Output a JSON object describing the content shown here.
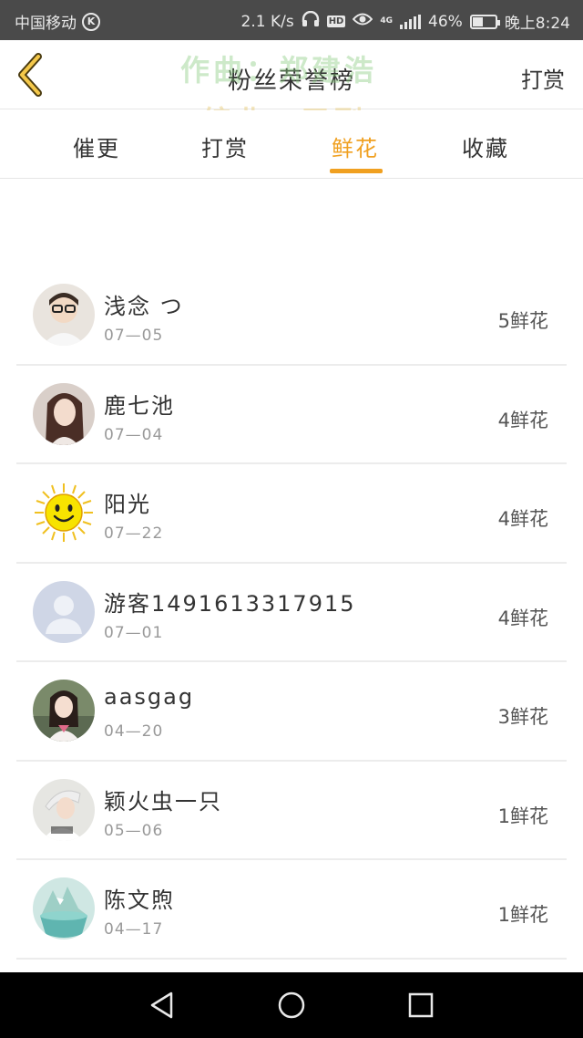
{
  "status_bar": {
    "carrier": "中国移动",
    "carrier_badge": "K",
    "speed": "2.1 K/s",
    "hd": "HD",
    "network": "4G",
    "battery": "46%",
    "battery_level": 0.46,
    "time": "晚上8:24",
    "icons": [
      "headphones-icon",
      "eye-icon",
      "signal-icon",
      "battery-icon"
    ]
  },
  "header": {
    "title": "粉丝荣誉榜",
    "reward": "打赏",
    "back_icon": "chevron-left-icon",
    "watermark_line1": "作曲：郑建浩",
    "watermark_line2": "编曲：于刚"
  },
  "tabs": [
    {
      "label": "催更",
      "active": false
    },
    {
      "label": "打赏",
      "active": false
    },
    {
      "label": "鲜花",
      "active": true
    },
    {
      "label": "收藏",
      "active": false
    }
  ],
  "fans": [
    {
      "name": "浅念 つ",
      "date": "07—05",
      "flowers": "5鲜花",
      "avatar": "avatar-photo"
    },
    {
      "name": "鹿七池",
      "date": "07—04",
      "flowers": "4鲜花",
      "avatar": "avatar-photo"
    },
    {
      "name": "阳光",
      "date": "07—22",
      "flowers": "4鲜花",
      "avatar": "sun-smiley-icon"
    },
    {
      "name": "游客1491613317915",
      "date": "07—01",
      "flowers": "4鲜花",
      "avatar": "default-user-icon"
    },
    {
      "name": "aasgag",
      "date": "04—20",
      "flowers": "3鲜花",
      "avatar": "avatar-photo"
    },
    {
      "name": "颖火虫一只",
      "date": "05—06",
      "flowers": "1鲜花",
      "avatar": "avatar-photo"
    },
    {
      "name": "陈文煦",
      "date": "04—17",
      "flowers": "1鲜花",
      "avatar": "avatar-photo"
    }
  ],
  "nav_bar": {
    "buttons": [
      "back-triangle-icon",
      "home-circle-icon",
      "recents-square-icon"
    ]
  },
  "colors": {
    "accent": "#f0a020",
    "status_bar": "#4a4a4a",
    "nav_bar": "#000000",
    "separator": "#ececec"
  }
}
